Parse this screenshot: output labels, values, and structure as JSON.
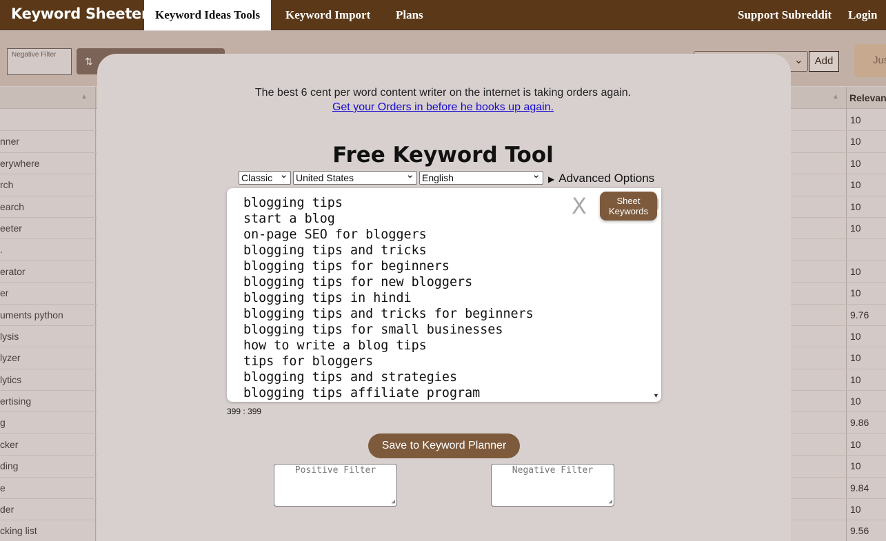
{
  "nav": {
    "brand": "Keyword Sheeter",
    "links": [
      "Keyword Ideas Tools",
      "Keyword Import",
      "Plans"
    ],
    "support": "Support Subreddit",
    "login": "Login"
  },
  "background": {
    "negative_filter_placeholder": "Negative Filter",
    "add_button": "Add",
    "partial_button": "Jus",
    "relevance_header": "Relevan",
    "rows": [
      {
        "keyword": "",
        "relevance": "10"
      },
      {
        "keyword": "nner",
        "relevance": "10"
      },
      {
        "keyword": "erywhere",
        "relevance": "10"
      },
      {
        "keyword": "rch",
        "relevance": "10"
      },
      {
        "keyword": "earch",
        "relevance": "10"
      },
      {
        "keyword": "eeter",
        "relevance": "10"
      },
      {
        "keyword": ".",
        "relevance": ""
      },
      {
        "keyword": "erator",
        "relevance": "10"
      },
      {
        "keyword": "er",
        "relevance": "10"
      },
      {
        "keyword": "uments python",
        "relevance": "9.76"
      },
      {
        "keyword": "lysis",
        "relevance": "10"
      },
      {
        "keyword": "lyzer",
        "relevance": "10"
      },
      {
        "keyword": "lytics",
        "relevance": "10"
      },
      {
        "keyword": "ertising",
        "relevance": "10"
      },
      {
        "keyword": "g",
        "relevance": "9.86"
      },
      {
        "keyword": "cker",
        "relevance": "10"
      },
      {
        "keyword": "ding",
        "relevance": "10"
      },
      {
        "keyword": "e",
        "relevance": "9.84"
      },
      {
        "keyword": "der",
        "relevance": "10"
      },
      {
        "keyword": "cking list",
        "relevance": "9.56"
      }
    ]
  },
  "modal": {
    "promo_text": "The best 6 cent per word content writer on the internet is taking orders again.",
    "promo_link": "Get your Orders in before he books up again.",
    "title": "Free Keyword Tool",
    "mode_select": "Classic",
    "country_select": "United States",
    "language_select": "English",
    "advanced_options": "Advanced Options",
    "clear_label": "X",
    "sheet_button": "Sheet\nKeywords",
    "keywords": [
      "blogging tips",
      "start a blog",
      "on-page SEO for bloggers",
      "blogging tips and tricks",
      "blogging tips for beginners",
      "blogging tips for new bloggers",
      "blogging tips in hindi",
      "blogging tips and tricks for beginners",
      "blogging tips for small businesses",
      "how to write a blog tips",
      "tips for bloggers",
      "blogging tips and strategies",
      "blogging tips affiliate program"
    ],
    "counter": "399 : 399",
    "save_button": "Save to Keyword Planner",
    "positive_filter_placeholder": "Positive Filter",
    "negative_filter_placeholder": "Negative Filter"
  },
  "colors": {
    "nav_bg": "#5b3818",
    "button_brown": "#7d5a3c",
    "link_blue": "#1a0dcc"
  }
}
